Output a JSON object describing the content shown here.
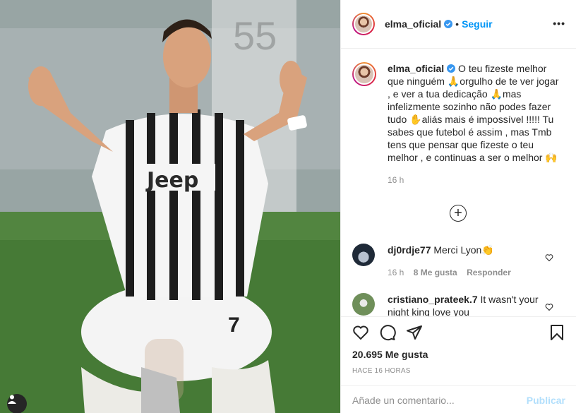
{
  "post": {
    "author": "elma_oficial",
    "follow_label": "Seguir",
    "dot": "•",
    "more_label": "•••"
  },
  "caption": {
    "username": "elma_oficial",
    "text": " O teu fizeste melhor que ninguém 🙏orgulho de te ver jogar , e ver a tua dedicação 🙏mas infelizmente sozinho não podes fazer tudo ✋aliás mais é impossível !!!!! Tu sabes que futebol é assim , mas Tmb tens que pensar que fizeste o teu melhor , e continuas a ser o melhor 🙌",
    "time": "16 h"
  },
  "comments": [
    {
      "username": "dj0rdje77",
      "text": " Merci Lyon👏",
      "time": "16 h",
      "likes": "8 Me gusta",
      "reply": "Responder"
    },
    {
      "username": "cristiano_prateek.7",
      "text": " It wasn't your night king love you",
      "time": "",
      "likes": "",
      "reply": ""
    }
  ],
  "stats": {
    "likes": "20.695 Me gusta",
    "ago": "HACE 16 HORAS"
  },
  "compose": {
    "placeholder": "Añade un comentario...",
    "publish_label": "Publicar"
  },
  "photo": {
    "jersey_text": "Jeep",
    "number": "7",
    "background_number": "55"
  },
  "colors": {
    "accent": "#0095f6",
    "muted": "#8e8e8e",
    "border": "#efefef",
    "publish_disabled": "#b2dffc"
  },
  "icons": [
    "verified-icon",
    "heart-icon",
    "comment-icon",
    "share-icon",
    "bookmark-icon",
    "plus-circle-icon",
    "tag-user-icon"
  ]
}
